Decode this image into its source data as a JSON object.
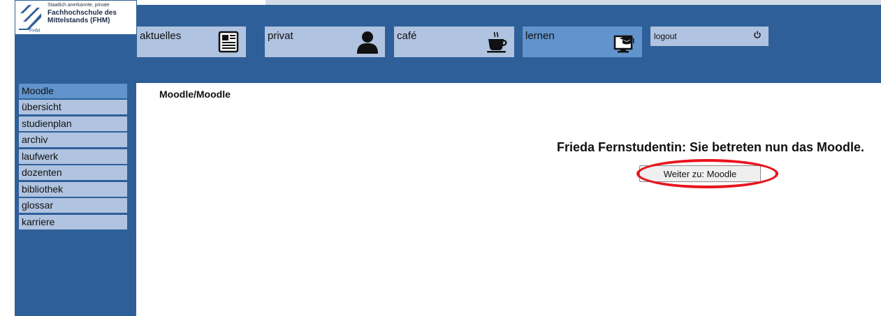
{
  "logo": {
    "line_small": "Staatlich anerkannte, private",
    "line1": "Fachhochschule des",
    "line2": "Mittelstands (FHM)",
    "abbr": "FHM"
  },
  "nav": {
    "tiles": [
      {
        "label": "aktuelles",
        "icon": "newspaper-icon"
      },
      {
        "label": "privat",
        "icon": "person-icon"
      },
      {
        "label": "café",
        "icon": "coffee-cup-icon"
      },
      {
        "label": "lernen",
        "icon": "monitor-graduation-icon",
        "active": true
      }
    ],
    "logout_label": "logout",
    "logout_icon": "power-icon"
  },
  "sidebar": {
    "items": [
      {
        "label": "Moodle",
        "active": true
      },
      {
        "label": "übersicht"
      },
      {
        "label": "studienplan"
      },
      {
        "label": "archiv"
      },
      {
        "label": "laufwerk"
      },
      {
        "label": "dozenten"
      },
      {
        "label": "bibliothek"
      },
      {
        "label": "glossar"
      },
      {
        "label": "karriere"
      }
    ]
  },
  "main": {
    "breadcrumb": "Moodle/Moodle",
    "welcome": "Frieda Fernstudentin: Sie betreten nun das Moodle.",
    "continue_button": "Weiter zu: Moodle"
  },
  "colors": {
    "header_bg": "#2f5f98",
    "tile_bg": "#b0c3e0",
    "tile_active": "#6194cc",
    "highlight_circle": "#e8141d"
  }
}
